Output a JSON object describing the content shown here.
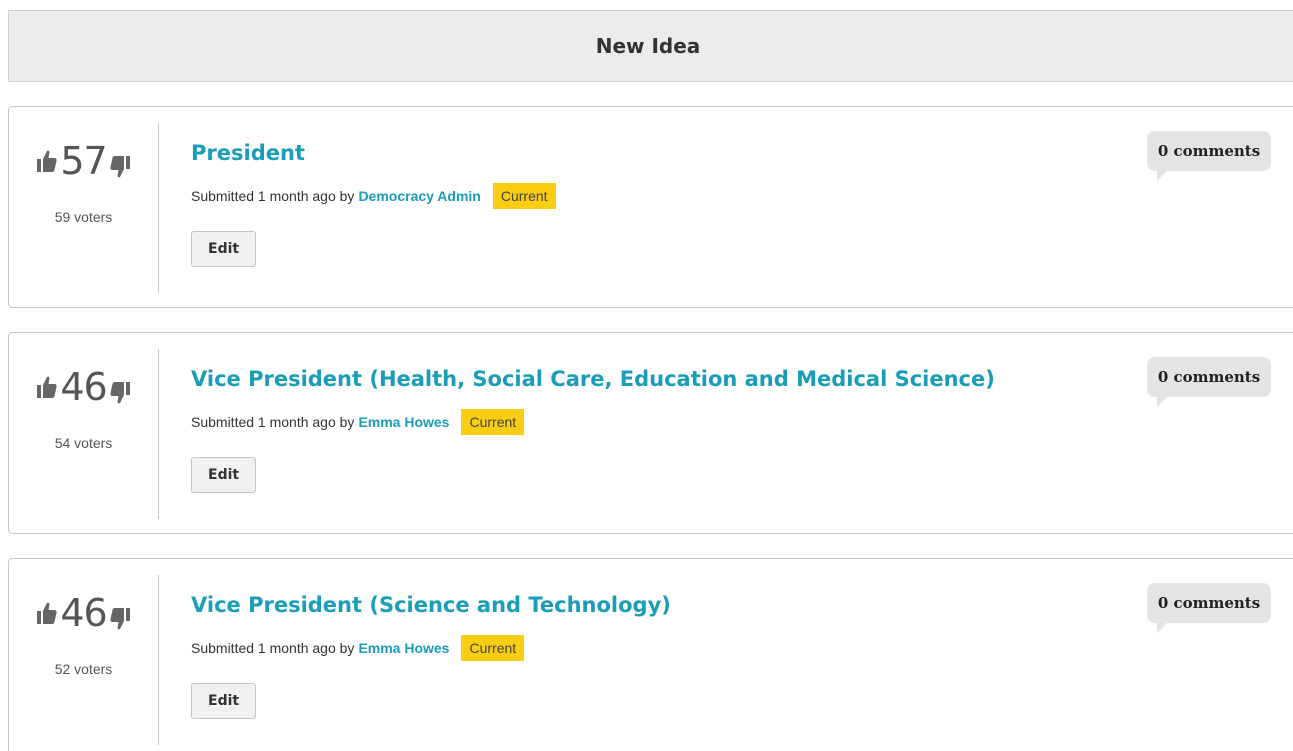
{
  "header": {
    "new_idea_label": "New Idea"
  },
  "colors": {
    "link": "#1a9db8",
    "status_current": "#f9cd12",
    "bubble": "#e4e4e4"
  },
  "ideas": [
    {
      "score": "57",
      "voters": "59 voters",
      "title": "President",
      "submitted_text": "Submitted 1 month ago by",
      "author": "Democracy Admin",
      "status": "Current",
      "edit_label": "Edit",
      "comments": "0 comments"
    },
    {
      "score": "46",
      "voters": "54 voters",
      "title": "Vice President (Health, Social Care, Education and Medical Science)",
      "submitted_text": "Submitted 1 month ago by",
      "author": "Emma Howes",
      "status": "Current",
      "edit_label": "Edit",
      "comments": "0 comments"
    },
    {
      "score": "46",
      "voters": "52 voters",
      "title": "Vice President (Science and Technology)",
      "submitted_text": "Submitted 1 month ago by",
      "author": "Emma Howes",
      "status": "Current",
      "edit_label": "Edit",
      "comments": "0 comments"
    }
  ]
}
